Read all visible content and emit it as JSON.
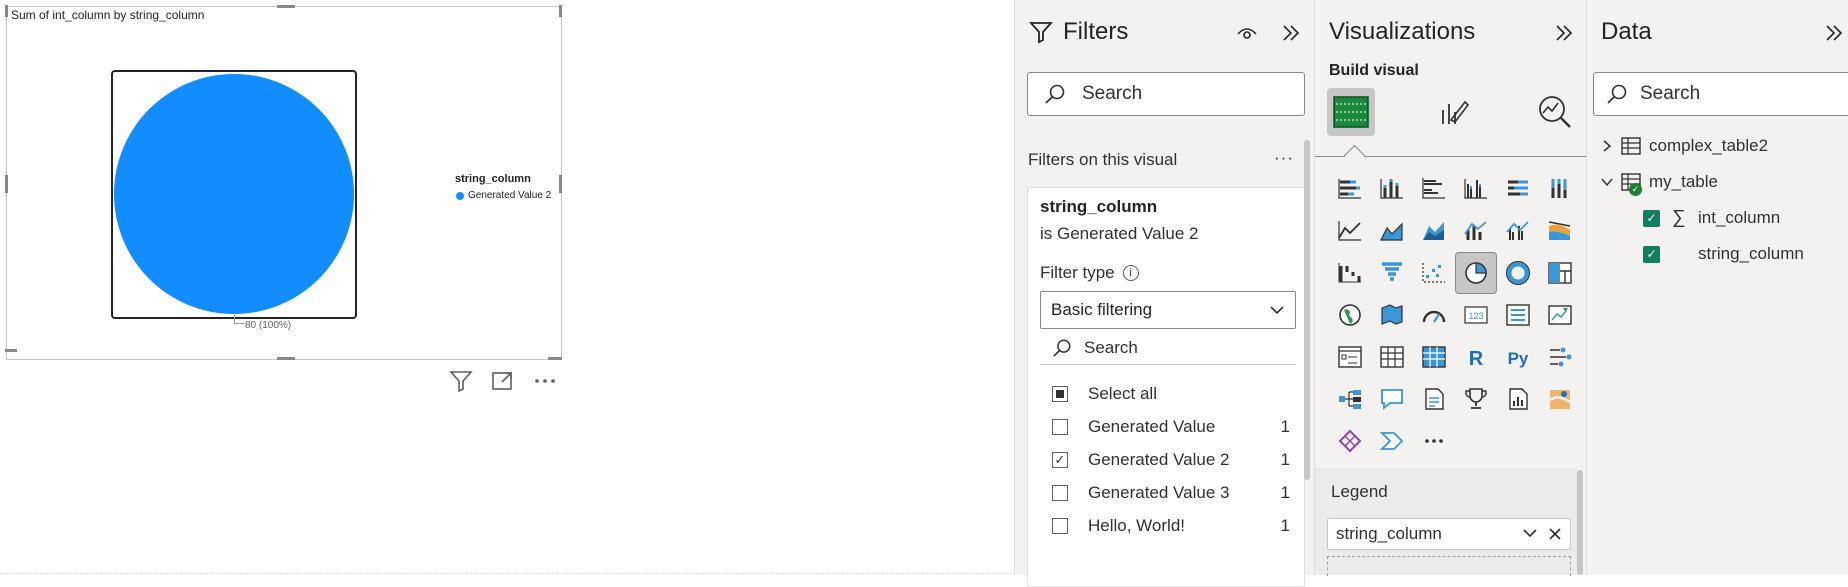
{
  "canvas": {
    "visual": {
      "title": "Sum of int_column by string_column",
      "legend_title": "string_column",
      "legend_items": [
        {
          "label": "Generated Value 2",
          "color": "#118DFF"
        }
      ],
      "data_label": "80 (100%)"
    }
  },
  "chart_data": {
    "type": "pie",
    "title": "Sum of int_column by string_column",
    "legend_title": "string_column",
    "categories": [
      "Generated Value 2"
    ],
    "values": [
      80
    ],
    "percents": [
      100
    ],
    "colors": [
      "#118DFF"
    ],
    "legend_position": "right"
  },
  "filters": {
    "title": "Filters",
    "search_placeholder": "Search",
    "section_label": "Filters on this visual",
    "card": {
      "field": "string_column",
      "description": "is Generated Value 2",
      "filter_type_label": "Filter type",
      "filter_type_value": "Basic filtering",
      "search_placeholder": "Search",
      "items": [
        {
          "label": "Select all",
          "count": "",
          "state": "partial"
        },
        {
          "label": "Generated Value",
          "count": "1",
          "state": "unchecked"
        },
        {
          "label": "Generated Value 2",
          "count": "1",
          "state": "checked"
        },
        {
          "label": "Generated Value 3",
          "count": "1",
          "state": "unchecked"
        },
        {
          "label": "Hello, World!",
          "count": "1",
          "state": "unchecked"
        }
      ]
    }
  },
  "visualizations": {
    "title": "Visualizations",
    "build_label": "Build visual",
    "legend_well_label": "Legend",
    "legend_field": "string_column",
    "accent": "#118DFF"
  },
  "data_pane": {
    "title": "Data",
    "search_placeholder": "Search",
    "tables": [
      {
        "name": "complex_table2",
        "expanded": false
      },
      {
        "name": "my_table",
        "expanded": true
      }
    ],
    "fields": [
      {
        "name": "int_column",
        "type": "sum",
        "checked": true
      },
      {
        "name": "string_column",
        "type": "text",
        "checked": true
      }
    ]
  }
}
